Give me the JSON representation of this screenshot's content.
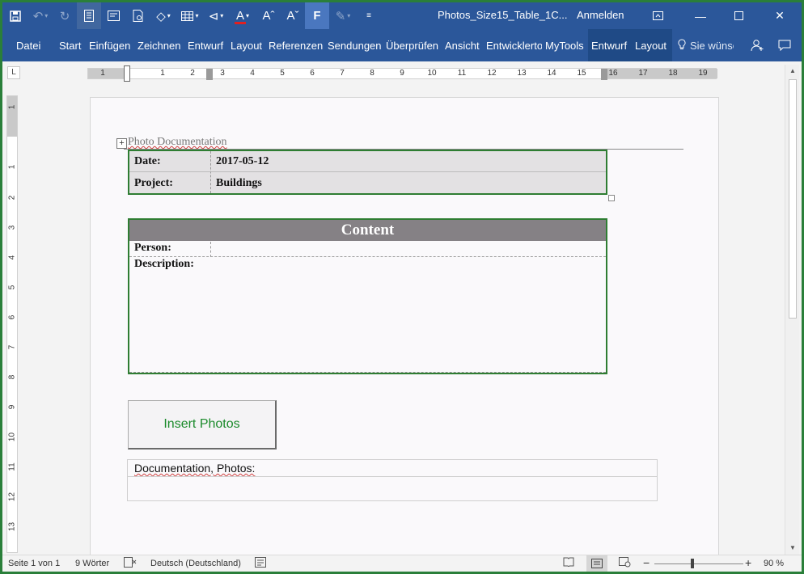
{
  "titlebar": {
    "doc_title": "Photos_Size15_Table_1C...",
    "sign_in": "Anmelden",
    "qat_icons": [
      "save-icon",
      "undo-icon",
      "redo-icon",
      "draft-view-icon",
      "preview-icon",
      "print-preview-icon",
      "shapes-icon",
      "table-icon",
      "draw-icon",
      "font-color-icon",
      "grow-font-icon",
      "shrink-font-icon",
      "custom-f-icon",
      "highlight-icon",
      "customize-qat-icon"
    ],
    "f_label": "F",
    "font_color_glyph": "A",
    "grow_font_glyph": "Aˆ",
    "shrink_font_glyph": "Aˇ"
  },
  "window_controls": [
    "ribbon-options-icon",
    "minimize-icon",
    "maximize-icon",
    "close-icon"
  ],
  "tabs": [
    "Datei",
    "Start",
    "Einfügen",
    "Zeichnen",
    "Entwurf",
    "Layout",
    "Referenzen",
    "Sendungen",
    "Überprüfen",
    "Ansicht",
    "Entwicklertools",
    "MyTools",
    "Entwurf",
    "Layout"
  ],
  "tell_me": "Sie wünschen",
  "ruler": {
    "corner": "L",
    "h_numbers": [
      "1",
      "",
      "1",
      "2",
      "3",
      "4",
      "5",
      "6",
      "7",
      "8",
      "9",
      "10",
      "11",
      "12",
      "13",
      "14",
      "15",
      "16",
      "17",
      "18",
      "19"
    ],
    "v_numbers": [
      "1",
      "",
      "1",
      "2",
      "3",
      "4",
      "5",
      "6",
      "7",
      "8",
      "9",
      "10",
      "11",
      "12",
      "13"
    ]
  },
  "document": {
    "header": "Photo Documentation",
    "info_table": [
      {
        "label": "Date:",
        "value": "2017-05-12"
      },
      {
        "label": "Project:",
        "value": "Buildings"
      }
    ],
    "content_table": {
      "title": "Content",
      "person_label": "Person:",
      "description_label": "Description:"
    },
    "insert_button": "Insert Photos",
    "photos_label": "Documentation, Photos:"
  },
  "status": {
    "page": "Seite 1 von 1",
    "words": "9 Wörter",
    "language": "Deutsch (Deutschland)",
    "zoom": "90 %",
    "zoom_level": 0.45
  }
}
